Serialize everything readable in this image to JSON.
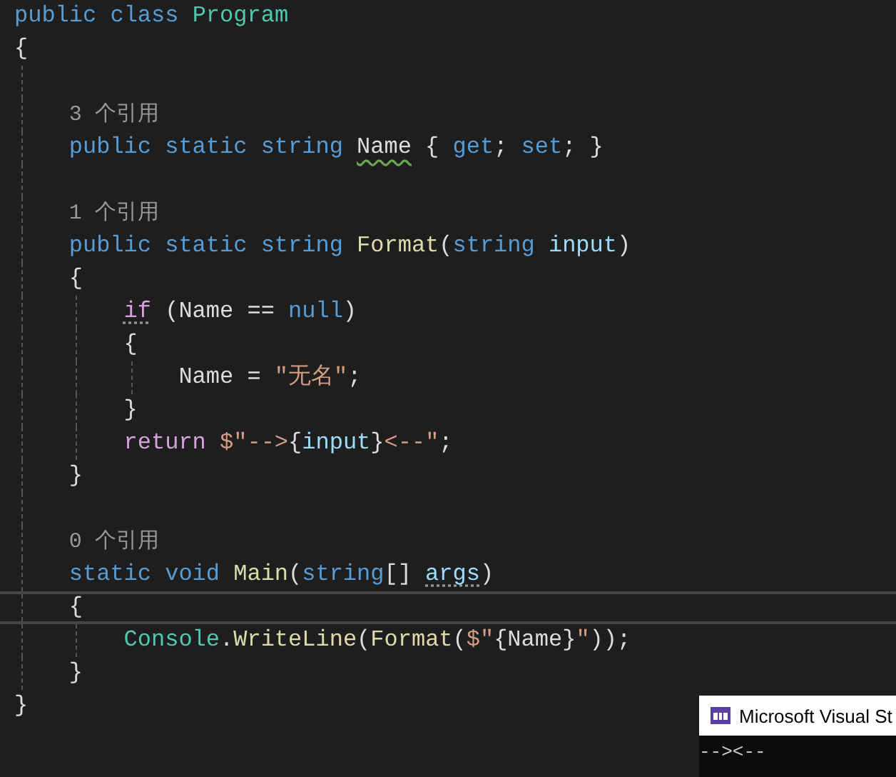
{
  "editor": {
    "lines": [
      {
        "kind": "code",
        "tokens": [
          {
            "t": "public class ",
            "kind": "kw"
          },
          {
            "t": "Program",
            "kind": "type"
          }
        ]
      },
      {
        "kind": "code",
        "tokens": [
          {
            "t": "{",
            "kind": "plain"
          }
        ],
        "children": [
          {
            "kind": "blank"
          },
          {
            "kind": "lens",
            "tokens": [
              {
                "t": "3 个引用",
                "kind": "lens"
              }
            ]
          },
          {
            "kind": "code",
            "tokens": [
              {
                "t": "public static string ",
                "kind": "kw"
              },
              {
                "t": "Name",
                "kind": "plain",
                "warning": true
              },
              {
                "t": " { ",
                "kind": "plain"
              },
              {
                "t": "get",
                "kind": "kw"
              },
              {
                "t": "; ",
                "kind": "plain"
              },
              {
                "t": "set",
                "kind": "kw"
              },
              {
                "t": "; }",
                "kind": "plain"
              }
            ]
          },
          {
            "kind": "blank"
          },
          {
            "kind": "lens",
            "tokens": [
              {
                "t": "1 个引用",
                "kind": "lens"
              }
            ]
          },
          {
            "kind": "code",
            "tokens": [
              {
                "t": "public static string ",
                "kind": "kw"
              },
              {
                "t": "Format",
                "kind": "method"
              },
              {
                "t": "(",
                "kind": "plain"
              },
              {
                "t": "string ",
                "kind": "kw"
              },
              {
                "t": "input",
                "kind": "param"
              },
              {
                "t": ")",
                "kind": "plain"
              }
            ]
          },
          {
            "kind": "code",
            "tokens": [
              {
                "t": "{",
                "kind": "plain"
              }
            ],
            "children": [
              {
                "kind": "code",
                "tokens": [
                  {
                    "t": "if",
                    "kind": "ctl",
                    "hint": true
                  },
                  {
                    "t": " (Name == ",
                    "kind": "plain"
                  },
                  {
                    "t": "null",
                    "kind": "kw"
                  },
                  {
                    "t": ")",
                    "kind": "plain"
                  }
                ]
              },
              {
                "kind": "code",
                "tokens": [
                  {
                    "t": "{",
                    "kind": "plain"
                  }
                ],
                "children": [
                  {
                    "kind": "code",
                    "tokens": [
                      {
                        "t": "Name = ",
                        "kind": "plain"
                      },
                      {
                        "t": "\"无名\"",
                        "kind": "string"
                      },
                      {
                        "t": ";",
                        "kind": "plain"
                      }
                    ]
                  }
                ]
              },
              {
                "kind": "code",
                "tokens": [
                  {
                    "t": "}",
                    "kind": "plain"
                  }
                ]
              },
              {
                "kind": "code",
                "tokens": [
                  {
                    "t": "return ",
                    "kind": "ctl"
                  },
                  {
                    "t": "$\"-->",
                    "kind": "string"
                  },
                  {
                    "t": "{",
                    "kind": "plain"
                  },
                  {
                    "t": "input",
                    "kind": "param"
                  },
                  {
                    "t": "}",
                    "kind": "plain"
                  },
                  {
                    "t": "<--\"",
                    "kind": "string"
                  },
                  {
                    "t": ";",
                    "kind": "plain"
                  }
                ]
              }
            ]
          },
          {
            "kind": "code",
            "tokens": [
              {
                "t": "}",
                "kind": "plain"
              }
            ]
          },
          {
            "kind": "blank"
          },
          {
            "kind": "lens",
            "tokens": [
              {
                "t": "0 个引用",
                "kind": "lens"
              }
            ]
          },
          {
            "kind": "code",
            "tokens": [
              {
                "t": "static void ",
                "kind": "kw"
              },
              {
                "t": "Main",
                "kind": "method"
              },
              {
                "t": "(",
                "kind": "plain"
              },
              {
                "t": "string",
                "kind": "kw"
              },
              {
                "t": "[] ",
                "kind": "plain"
              },
              {
                "t": "args",
                "kind": "param",
                "hint": true
              },
              {
                "t": ")",
                "kind": "plain"
              }
            ]
          },
          {
            "kind": "code",
            "current": true,
            "tokens": [
              {
                "t": "{",
                "kind": "plain"
              }
            ],
            "children": [
              {
                "kind": "code",
                "tokens": [
                  {
                    "t": "Console",
                    "kind": "type"
                  },
                  {
                    "t": ".",
                    "kind": "plain"
                  },
                  {
                    "t": "WriteLine",
                    "kind": "method"
                  },
                  {
                    "t": "(",
                    "kind": "plain"
                  },
                  {
                    "t": "Format",
                    "kind": "method"
                  },
                  {
                    "t": "(",
                    "kind": "plain"
                  },
                  {
                    "t": "$\"",
                    "kind": "string"
                  },
                  {
                    "t": "{Name}",
                    "kind": "plain"
                  },
                  {
                    "t": "\"",
                    "kind": "string"
                  },
                  {
                    "t": "));",
                    "kind": "plain"
                  }
                ]
              }
            ]
          },
          {
            "kind": "code",
            "tokens": [
              {
                "t": "}",
                "kind": "plain"
              }
            ]
          }
        ]
      },
      {
        "kind": "code",
        "tokens": [
          {
            "t": "}",
            "kind": "plain"
          }
        ]
      }
    ]
  },
  "console_window": {
    "title": "Microsoft Visual St",
    "output": "--><--"
  }
}
